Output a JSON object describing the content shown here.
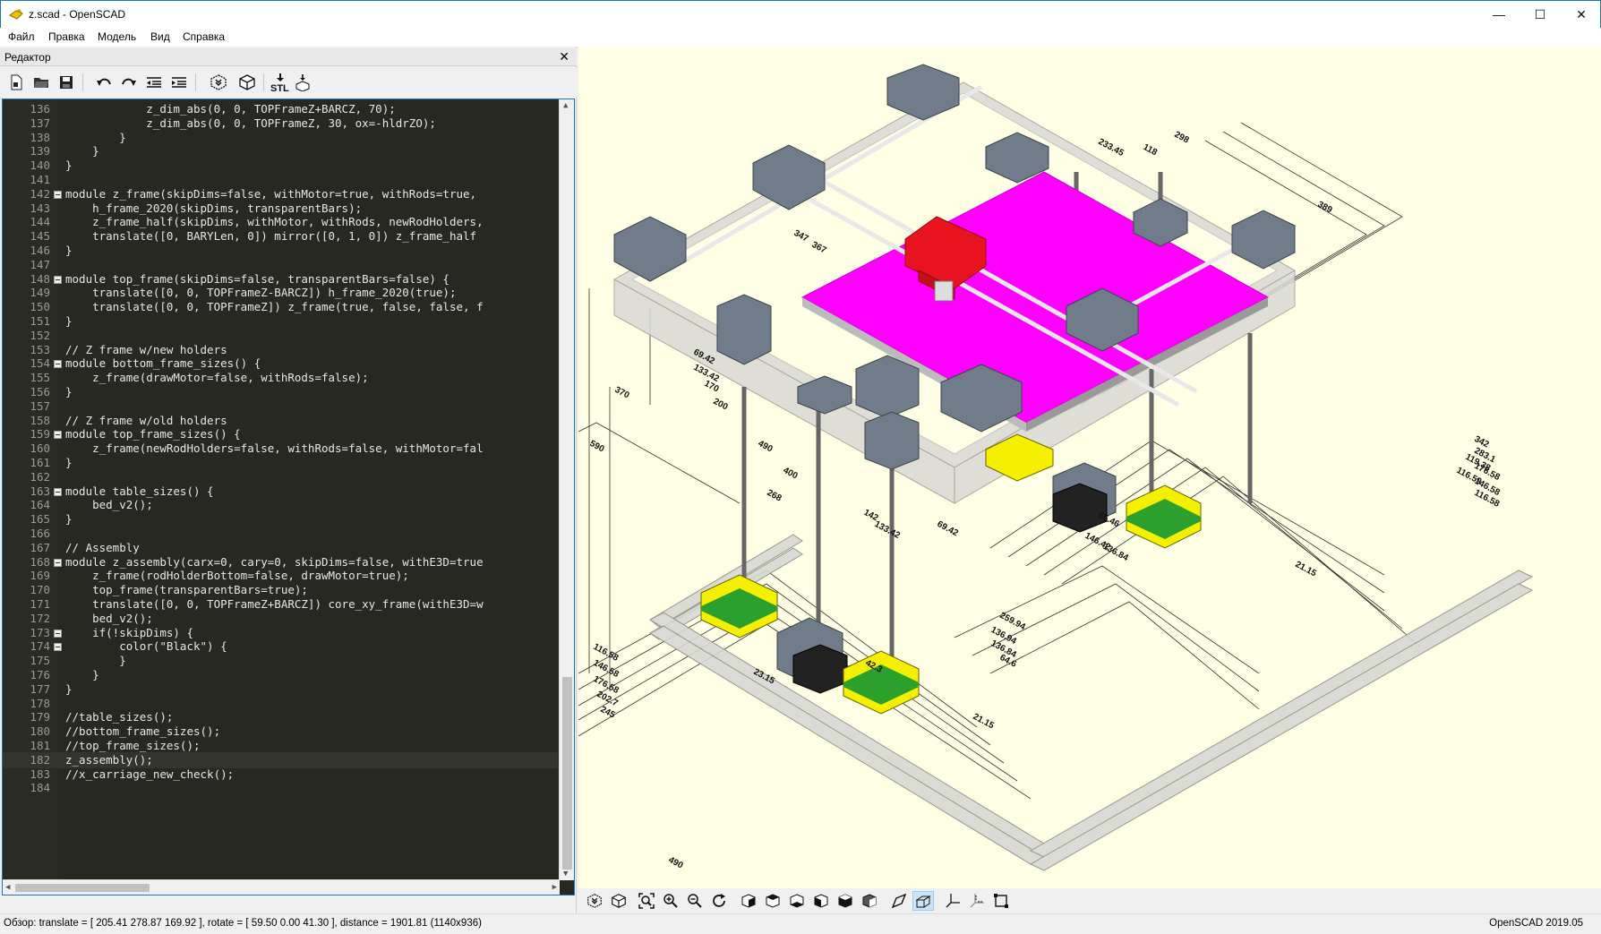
{
  "window": {
    "title": "z.scad - OpenSCAD",
    "minimize": "—",
    "maximize": "☐",
    "close": "✕"
  },
  "menu": {
    "items": [
      "Файл",
      "Правка",
      "Модель",
      "Вид",
      "Справка"
    ]
  },
  "editor": {
    "title": "Редактор",
    "close_label": "✕",
    "toolbar_icons": [
      "new-file-icon",
      "open-file-icon",
      "save-icon",
      "undo-icon",
      "redo-icon",
      "unindent-icon",
      "indent-icon",
      "preview-icon",
      "render-icon",
      "export-stl-icon",
      "send-to-print-icon"
    ],
    "stl_label": "STL",
    "current_line": 182,
    "lines": [
      {
        "n": "136",
        "t": "            z_dim_abs(0, 0, TOPFrameZ+BARCZ, 70);"
      },
      {
        "n": "137",
        "t": "            z_dim_abs(0, 0, TOPFrameZ, 30, ox=-hldrZO);"
      },
      {
        "n": "138",
        "t": "        }"
      },
      {
        "n": "139",
        "t": "    }"
      },
      {
        "n": "140",
        "t": "}"
      },
      {
        "n": "141",
        "t": ""
      },
      {
        "n": "142",
        "t": "module z_frame(skipDims=false, withMotor=true, withRods=true, ",
        "fold": true
      },
      {
        "n": "143",
        "t": "    h_frame_2020(skipDims, transparentBars);"
      },
      {
        "n": "144",
        "t": "    z_frame_half(skipDims, withMotor, withRods, newRodHolders,"
      },
      {
        "n": "145",
        "t": "    translate([0, BARYLen, 0]) mirror([0, 1, 0]) z_frame_half "
      },
      {
        "n": "146",
        "t": "}"
      },
      {
        "n": "147",
        "t": ""
      },
      {
        "n": "148",
        "t": "module top_frame(skipDims=false, transparentBars=false) {",
        "fold": true
      },
      {
        "n": "149",
        "t": "    translate([0, 0, TOPFrameZ-BARCZ]) h_frame_2020(true);"
      },
      {
        "n": "150",
        "t": "    translate([0, 0, TOPFrameZ]) z_frame(true, false, false, f"
      },
      {
        "n": "151",
        "t": "}"
      },
      {
        "n": "152",
        "t": ""
      },
      {
        "n": "153",
        "t": "// Z frame w/new holders"
      },
      {
        "n": "154",
        "t": "module bottom_frame_sizes() {",
        "fold": true
      },
      {
        "n": "155",
        "t": "    z_frame(drawMotor=false, withRods=false);"
      },
      {
        "n": "156",
        "t": "}"
      },
      {
        "n": "157",
        "t": ""
      },
      {
        "n": "158",
        "t": "// Z frame w/old holders"
      },
      {
        "n": "159",
        "t": "module top_frame_sizes() {",
        "fold": true
      },
      {
        "n": "160",
        "t": "    z_frame(newRodHolders=false, withRods=false, withMotor=fal"
      },
      {
        "n": "161",
        "t": "}"
      },
      {
        "n": "162",
        "t": ""
      },
      {
        "n": "163",
        "t": "module table_sizes() {",
        "fold": true
      },
      {
        "n": "164",
        "t": "    bed_v2();"
      },
      {
        "n": "165",
        "t": "}"
      },
      {
        "n": "166",
        "t": ""
      },
      {
        "n": "167",
        "t": "// Assembly"
      },
      {
        "n": "168",
        "t": "module z_assembly(carx=0, cary=0, skipDims=false, withE3D=true",
        "fold": true
      },
      {
        "n": "169",
        "t": "    z_frame(rodHolderBottom=false, drawMotor=true);"
      },
      {
        "n": "170",
        "t": "    top_frame(transparentBars=true);"
      },
      {
        "n": "171",
        "t": "    translate([0, 0, TOPFrameZ+BARCZ]) core_xy_frame(withE3D=w"
      },
      {
        "n": "172",
        "t": "    bed_v2();"
      },
      {
        "n": "173",
        "t": "    if(!skipDims) {",
        "fold": true
      },
      {
        "n": "174",
        "t": "        color(\"Black\") {",
        "fold": true
      },
      {
        "n": "175",
        "t": "        }"
      },
      {
        "n": "176",
        "t": "    }"
      },
      {
        "n": "177",
        "t": "}"
      },
      {
        "n": "178",
        "t": ""
      },
      {
        "n": "179",
        "t": "//table_sizes();"
      },
      {
        "n": "180",
        "t": "//bottom_frame_sizes();"
      },
      {
        "n": "181",
        "t": "//top_frame_sizes();"
      },
      {
        "n": "182",
        "t": "z_assembly();"
      },
      {
        "n": "183",
        "t": "//x_carriage_new_check();"
      },
      {
        "n": "184",
        "t": ""
      }
    ]
  },
  "viewport": {
    "background": "#ffffe5",
    "bed_color": "#ff00ff",
    "carriage_color": "#e8131f",
    "holder_color": "#6e7b88",
    "foot_color": "#f5ef00",
    "dimension_labels": [
      "116.58",
      "146.58",
      "176.58",
      "202.7",
      "245",
      "490",
      "69.42",
      "133.42",
      "170",
      "200",
      "490",
      "370",
      "590",
      "400",
      "268",
      "142",
      "133.42",
      "69.42",
      "259.94",
      "136.94",
      "136.84",
      "64.6",
      "23.15",
      "42.3",
      "21.15",
      "347",
      "367",
      "118",
      "298",
      "389",
      "233.45",
      "116.59",
      "119.38",
      "136.84",
      "146.42",
      "65.46",
      "342",
      "283.1",
      "176.58",
      "146.58",
      "116.58",
      "21.15"
    ]
  },
  "view_toolbar": {
    "icons": [
      "preview-icon",
      "render-icon",
      "view-all-icon",
      "zoom-in-icon",
      "zoom-out-icon",
      "reset-view-icon",
      "view-right-icon",
      "view-top-icon",
      "view-bottom-icon",
      "view-left-icon",
      "view-front-icon",
      "view-back-icon",
      "perspective-icon",
      "orthogonal-icon",
      "axes-icon",
      "scale-markers-icon",
      "edges-icon"
    ],
    "active": "orthogonal-icon"
  },
  "status": {
    "left": "Обзор: translate = [ 205.41 278.87 169.92 ], rotate = [ 59.50 0.00 41.30 ], distance = 1901.81 (1140x936)",
    "right": "OpenSCAD 2019.05"
  }
}
